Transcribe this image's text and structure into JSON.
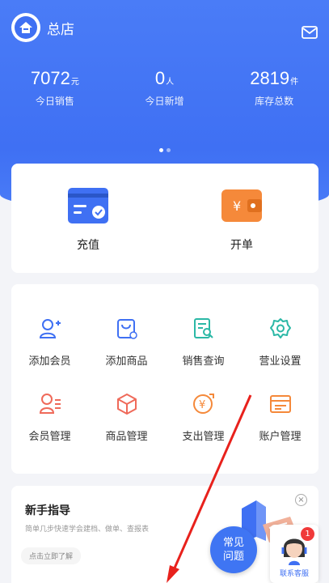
{
  "header": {
    "store_name": "总店",
    "logo_icon": "store-logo-icon",
    "mail_icon": "mail-icon"
  },
  "stats": [
    {
      "value": "7072",
      "unit": "元",
      "label": "今日销售"
    },
    {
      "value": "0",
      "unit": "人",
      "label": "今日新增"
    },
    {
      "value": "2819",
      "unit": "件",
      "label": "库存总数"
    }
  ],
  "carousel": {
    "pages": 2,
    "active": 1
  },
  "quick_actions": [
    {
      "label": "充值",
      "icon": "recharge-card-icon"
    },
    {
      "label": "开单",
      "icon": "wallet-order-icon"
    }
  ],
  "menu": [
    {
      "label": "添加会员",
      "icon": "add-member-icon"
    },
    {
      "label": "添加商品",
      "icon": "add-product-icon"
    },
    {
      "label": "销售查询",
      "icon": "sales-query-icon"
    },
    {
      "label": "营业设置",
      "icon": "settings-gear-icon"
    },
    {
      "label": "会员管理",
      "icon": "member-manage-icon"
    },
    {
      "label": "商品管理",
      "icon": "product-box-icon"
    },
    {
      "label": "支出管理",
      "icon": "expense-icon"
    },
    {
      "label": "账户管理",
      "icon": "account-icon"
    }
  ],
  "guide": {
    "title": "新手指导",
    "desc": "简单几步快速学会建档、做单、查报表",
    "link": "点击立即了解"
  },
  "floating": {
    "faq_line1": "常见",
    "faq_line2": "问题",
    "support_label": "联系客服",
    "badge_count": "1"
  },
  "colors": {
    "primary": "#3f70f3",
    "orange": "#f5893a",
    "teal": "#2bb8a6",
    "red_icon": "#ef6a5a",
    "badge": "#f03a3a"
  }
}
